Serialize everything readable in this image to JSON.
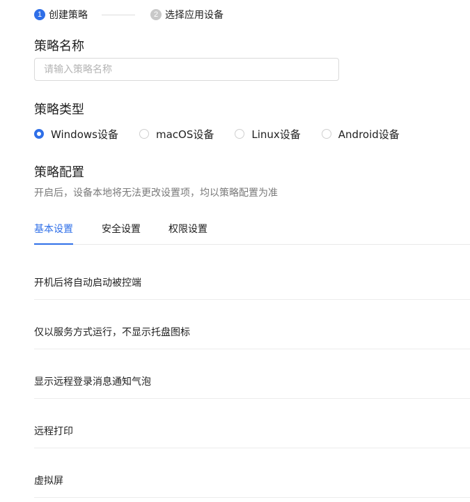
{
  "steps": [
    {
      "number": "1",
      "label": "创建策略",
      "active": true
    },
    {
      "number": "2",
      "label": "选择应用设备",
      "active": false
    }
  ],
  "name_section": {
    "title": "策略名称",
    "input_value": "",
    "placeholder": "请输入策略名称"
  },
  "type_section": {
    "title": "策略类型",
    "options": [
      {
        "label": "Windows设备",
        "selected": true
      },
      {
        "label": "macOS设备",
        "selected": false
      },
      {
        "label": "Linux设备",
        "selected": false
      },
      {
        "label": "Android设备",
        "selected": false
      }
    ]
  },
  "config_section": {
    "title": "策略配置",
    "description": "开启后，设备本地将无法更改设置项，均以策略配置为准",
    "tabs": [
      {
        "label": "基本设置",
        "active": true
      },
      {
        "label": "安全设置",
        "active": false
      },
      {
        "label": "权限设置",
        "active": false
      }
    ],
    "settings": [
      "开机后将自动启动被控端",
      "仅以服务方式运行，不显示托盘图标",
      "显示远程登录消息通知气泡",
      "远程打印",
      "虚拟屏"
    ]
  },
  "colors": {
    "accent": "#2f6fe8",
    "inactive_step": "#c8c8c8",
    "divider": "#ececec"
  }
}
